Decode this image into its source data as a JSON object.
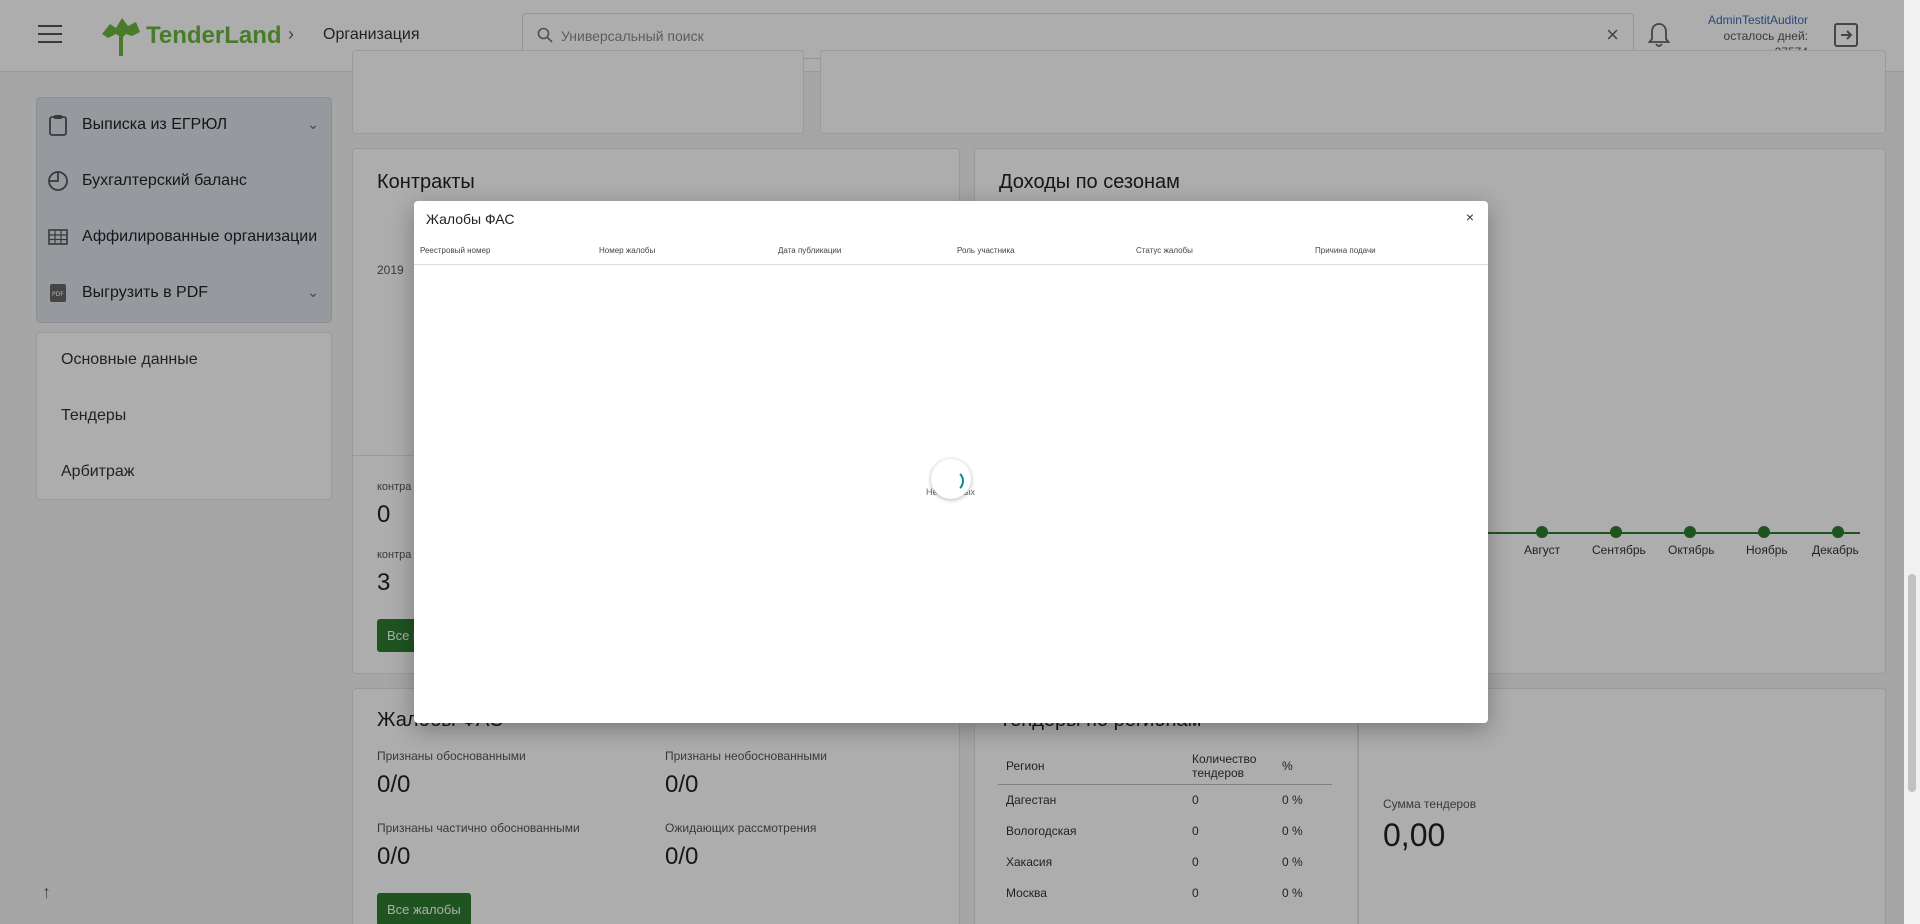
{
  "header": {
    "logo_text": "TenderLand",
    "breadcrumb_title": "Организация",
    "search_placeholder": "Универсальный поиск",
    "user_name": "AdminTestitAuditor",
    "days_left_label": "осталось дней:",
    "days_left_value": "27574"
  },
  "sidebar": {
    "group_items": [
      {
        "label": "Выписка из ЕГРЮЛ",
        "icon": "clipboard-icon",
        "has_chevron": true
      },
      {
        "label": "Бухгалтерский баланс",
        "icon": "pie-chart-icon",
        "has_chevron": false
      },
      {
        "label": "Аффилированные организации",
        "icon": "table-icon",
        "has_chevron": false
      },
      {
        "label": "Выгрузить в PDF",
        "icon": "pdf-icon",
        "has_chevron": true
      }
    ],
    "links": [
      "Основные данные",
      "Тендеры",
      "Арбитраж"
    ]
  },
  "contracts": {
    "title": "Контракты",
    "year_label": "2019",
    "stat1_label": "контра",
    "stat1_value": "0",
    "stat2_label": "контра",
    "stat2_value": "3",
    "button_label": "Все к"
  },
  "seasons": {
    "title": "Доходы по сезонам",
    "months": [
      "Август",
      "Сентябрь",
      "Октябрь",
      "Ноябрь",
      "Декабрь"
    ]
  },
  "complaints": {
    "title": "Жалобы ФАС",
    "stats": [
      {
        "label": "Признаны обоснованными",
        "value": "0/0"
      },
      {
        "label": "Признаны необоснованными",
        "value": "0/0"
      },
      {
        "label": "Признаны частично обоснованными",
        "value": "0/0"
      },
      {
        "label": "Ожидающих рассмотрения",
        "value": "0/0"
      }
    ],
    "button_label": "Все жалобы"
  },
  "regions": {
    "title": "Тендеры по регионам",
    "columns": [
      "Регион",
      "Количество тендеров",
      "%"
    ],
    "rows": [
      {
        "region": "Дагестан",
        "count": "0",
        "pct": "0 %"
      },
      {
        "region": "Вологодская",
        "count": "0",
        "pct": "0 %"
      },
      {
        "region": "Хакасия",
        "count": "0",
        "pct": "0 %"
      },
      {
        "region": "Москва",
        "count": "0",
        "pct": "0 %"
      }
    ]
  },
  "tender_sum": {
    "label": "Сумма тендеров",
    "value": "0,00"
  },
  "modal": {
    "title": "Жалобы ФАС",
    "close": "×",
    "columns": [
      "Реестровый номер",
      "Номер жалобы",
      "Дата публикации",
      "Роль участника",
      "Статус жалобы",
      "Причина подачи"
    ],
    "empty_text": "Нет данных"
  }
}
